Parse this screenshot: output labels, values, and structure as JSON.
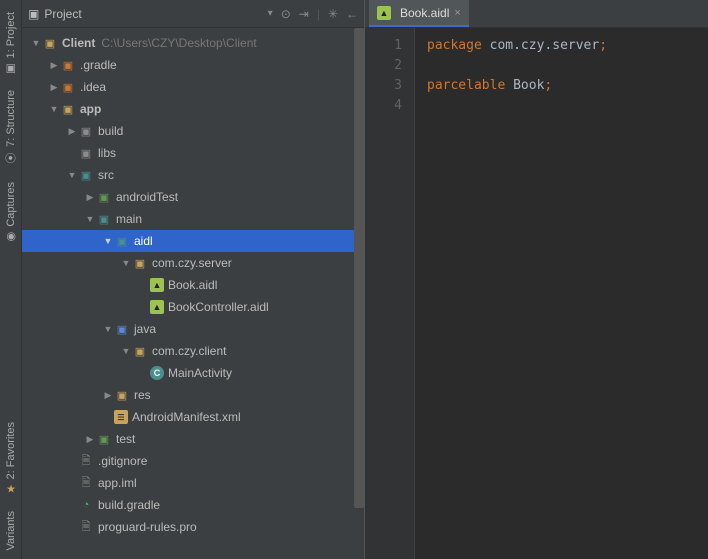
{
  "side_tabs": {
    "project": "1: Project",
    "structure": "7: Structure",
    "captures": "Captures",
    "favorites": "2: Favorites",
    "variants": "Variants"
  },
  "panel": {
    "title": "Project"
  },
  "tree": [
    {
      "indent": 0,
      "caret": "▼",
      "ico": "folder-yellow",
      "glyph": "▣",
      "label": "Client",
      "bold": true,
      "muted": "C:\\Users\\CZY\\Desktop\\Client"
    },
    {
      "indent": 1,
      "caret": "▶",
      "ico": "folder-orange",
      "glyph": "▣",
      "label": ".gradle"
    },
    {
      "indent": 1,
      "caret": "▶",
      "ico": "folder-orange",
      "glyph": "▣",
      "label": ".idea"
    },
    {
      "indent": 1,
      "caret": "▼",
      "ico": "folder-yellow",
      "glyph": "▣",
      "label": "app",
      "bold": true
    },
    {
      "indent": 2,
      "caret": "▶",
      "ico": "folder-gray",
      "glyph": "▣",
      "label": "build"
    },
    {
      "indent": 2,
      "caret": "",
      "ico": "folder-gray",
      "glyph": "▣",
      "label": "libs"
    },
    {
      "indent": 2,
      "caret": "▼",
      "ico": "folder-teal",
      "glyph": "▣",
      "label": "src"
    },
    {
      "indent": 3,
      "caret": "▶",
      "ico": "folder-green",
      "glyph": "▣",
      "label": "androidTest"
    },
    {
      "indent": 3,
      "caret": "▼",
      "ico": "folder-teal",
      "glyph": "▣",
      "label": "main"
    },
    {
      "indent": 4,
      "caret": "▼",
      "ico": "folder-teal",
      "glyph": "▣",
      "label": "aidl",
      "selected": true
    },
    {
      "indent": 5,
      "caret": "▼",
      "ico": "folder-yellow",
      "glyph": "▣",
      "label": "com.czy.server"
    },
    {
      "indent": 6,
      "caret": "",
      "ico": "android",
      "glyph": "▲",
      "label": "Book.aidl"
    },
    {
      "indent": 6,
      "caret": "",
      "ico": "android",
      "glyph": "▲",
      "label": "BookController.aidl"
    },
    {
      "indent": 4,
      "caret": "▼",
      "ico": "folder-blue",
      "glyph": "▣",
      "label": "java"
    },
    {
      "indent": 5,
      "caret": "▼",
      "ico": "folder-yellow",
      "glyph": "▣",
      "label": "com.czy.client"
    },
    {
      "indent": 6,
      "caret": "",
      "ico": "kotlin-c",
      "glyph": "C",
      "label": "MainActivity"
    },
    {
      "indent": 4,
      "caret": "▶",
      "ico": "folder-yellow",
      "glyph": "▣",
      "label": "res"
    },
    {
      "indent": 4,
      "caret": "",
      "ico": "xmlico",
      "glyph": "☰",
      "label": "AndroidManifest.xml"
    },
    {
      "indent": 3,
      "caret": "▶",
      "ico": "folder-green",
      "glyph": "▣",
      "label": "test"
    },
    {
      "indent": 2,
      "caret": "",
      "ico": "file",
      "glyph": "🗎",
      "label": ".gitignore"
    },
    {
      "indent": 2,
      "caret": "",
      "ico": "file",
      "glyph": "🗎",
      "label": "app.iml"
    },
    {
      "indent": 2,
      "caret": "",
      "ico": "gradle",
      "glyph": "◔",
      "label": "build.gradle"
    },
    {
      "indent": 2,
      "caret": "",
      "ico": "file",
      "glyph": "🗎",
      "label": "proguard-rules.pro"
    }
  ],
  "editor": {
    "tab_label": "Book.aidl",
    "lines": {
      "n1": "1",
      "n2": "2",
      "n3": "3",
      "n4": "4"
    },
    "code": {
      "l1_kw": "package",
      "l1_id": "com.czy.server",
      "l3_kw": "parcelable",
      "l3_id": "Book"
    }
  }
}
